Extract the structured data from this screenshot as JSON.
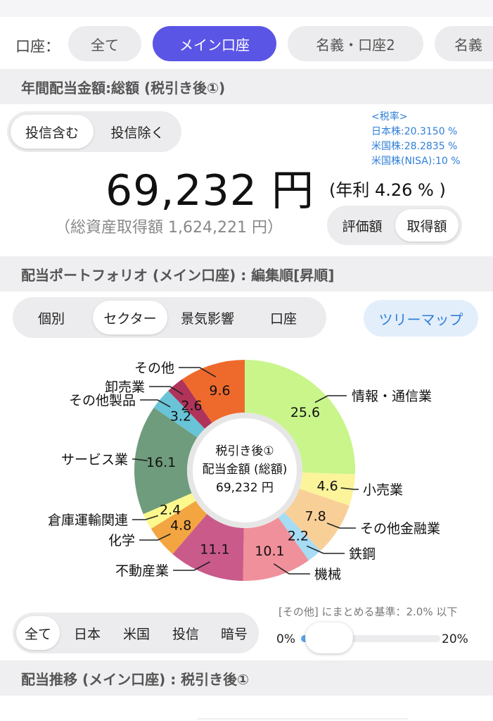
{
  "account_filter": {
    "label": "口座：",
    "chips": [
      "全て",
      "メイン口座",
      "名義・口座2",
      "名義"
    ],
    "active_index": 1
  },
  "annual_dividend": {
    "header": "年間配当金額:総額 (税引き後①)",
    "toggle": [
      "投信含む",
      "投信除く"
    ],
    "toggle_active": 0,
    "tax_rates": [
      "<税率>",
      "日本株:20.3150 %",
      "米国株:28.2835 %",
      "米国株(NISA):10 %"
    ],
    "amount": "69,232 円",
    "yield": "(年利 4.26 % )",
    "total_cost": "（総資産取得額 1,624,221 円）",
    "basis_toggle": [
      "評価額",
      "取得額"
    ],
    "basis_active": 1
  },
  "portfolio": {
    "header": "配当ポートフォリオ (メイン口座) : 編集順[昇順]",
    "view_tabs": [
      "個別",
      "セクター",
      "景気影響",
      "口座"
    ],
    "view_active": 1,
    "treemap_button": "ツリーマップ"
  },
  "chart_data": {
    "type": "pie",
    "center_text": [
      "税引き後①",
      "配当金額 (総額)",
      "69,232 円"
    ],
    "slices": [
      {
        "label": "情報・通信業",
        "value": 25.6,
        "color": "#c9f58b"
      },
      {
        "label": "小売業",
        "value": 4.6,
        "color": "#fbf49a"
      },
      {
        "label": "その他金融業",
        "value": 7.8,
        "color": "#f9cf98"
      },
      {
        "label": "鉄鋼",
        "value": 2.2,
        "color": "#a6dcf4"
      },
      {
        "label": "機械",
        "value": 10.1,
        "color": "#f0909b"
      },
      {
        "label": "不動産業",
        "value": 11.1,
        "color": "#c95a8a"
      },
      {
        "label": "化学",
        "value": 4.8,
        "color": "#f2a541"
      },
      {
        "label": "倉庫運輸関連",
        "value": 2.4,
        "color": "#fbf88e"
      },
      {
        "label": "サービス業",
        "value": 16.1,
        "color": "#6f9c7c"
      },
      {
        "label": "その他製品",
        "value": 3.2,
        "color": "#68c4d6"
      },
      {
        "label": "卸売業",
        "value": 2.6,
        "color": "#b0335a"
      },
      {
        "label": "その他",
        "value": 9.6,
        "color": "#ee6a2c"
      }
    ]
  },
  "region_filter": {
    "tabs": [
      "全て",
      "日本",
      "米国",
      "投信",
      "暗号"
    ],
    "active_index": 0
  },
  "others_threshold": {
    "note": "[その他] にまとめる基準：2.0% 以下",
    "min_label": "0%",
    "max_label": "20%",
    "value_percent": 2.0
  },
  "dividend_trend": {
    "header": "配当推移 (メイン口座) : 税引き後①"
  }
}
